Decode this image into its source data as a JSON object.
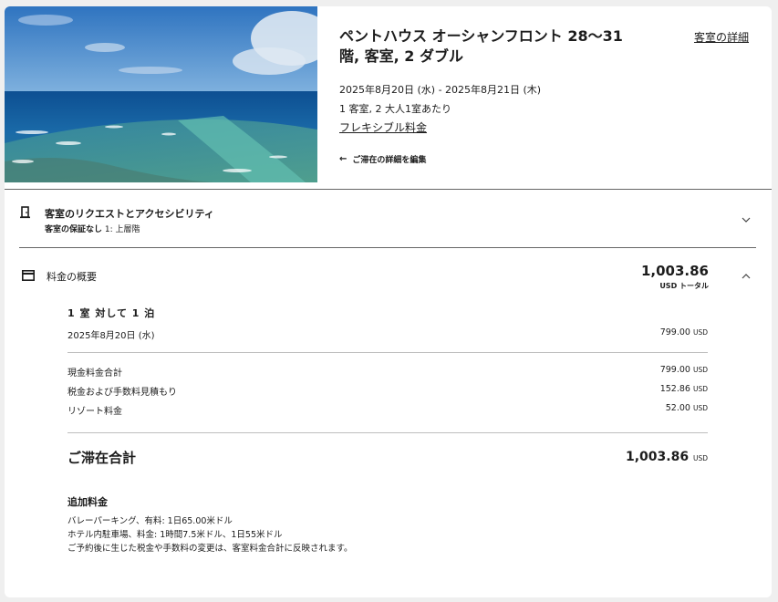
{
  "room": {
    "title": "ペントハウス オーシャンフロント 28〜31階, 客室, 2 ダブル",
    "details_link": "客室の詳細",
    "dates": "2025年8月20日 (水) - 2025年8月21日 (木)",
    "guests": "1 客室, 2 大人1室あたり",
    "rate_type": "フレキシブル料金",
    "edit_stay": "ご滞在の詳細を編集"
  },
  "requests": {
    "title": "客室のリクエストとアクセシビリティ",
    "sub_bold": "客室の保証なし",
    "sub_rest": " 1: 上層階"
  },
  "summary": {
    "title": "料金の概要",
    "total": "1,003.86",
    "total_unit": "USD トータル",
    "nights_heading": "1 室 対して 1 泊",
    "night_date": "2025年8月20日 (水)",
    "night_amount": "799.00",
    "currency": "USD",
    "lines": [
      {
        "label": "現金料金合計",
        "amount": "799.00"
      },
      {
        "label": "税金および手数料見積もり",
        "amount": "152.86"
      },
      {
        "label": "リゾート料金",
        "amount": "52.00"
      }
    ],
    "stay_total_label": "ご滞在合計",
    "stay_total_amount": "1,003.86"
  },
  "extras": {
    "title": "追加料金",
    "lines": [
      "バレーパーキング、有料: 1日65.00米ドル",
      "ホテル内駐車場、料金: 1時間7.5米ドル、1日55米ドル",
      "ご予約後に生じた税金や手数料の変更は、客室料金合計に反映されます。"
    ]
  },
  "colors": {
    "sky": "#3d7fc8",
    "ocean_deep": "#0f4d8a",
    "reef": "#4fa3a0",
    "text": "#1c1c1c"
  }
}
